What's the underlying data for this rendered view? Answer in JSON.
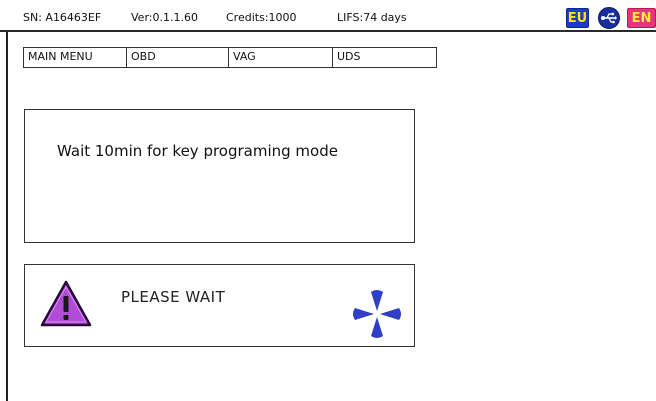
{
  "statusbar": {
    "sn": "SN: A16463EF",
    "version": "Ver:0.1.1.60",
    "credits": "Credits:1000",
    "lifs": "LIFS:74 days",
    "region_flag": "EU",
    "language_flag": "EN",
    "usb_icon": "usb-icon"
  },
  "menubar": {
    "items": [
      {
        "label": "MAIN MENU"
      },
      {
        "label": "OBD"
      },
      {
        "label": "VAG"
      },
      {
        "label": "UDS"
      }
    ]
  },
  "message": {
    "text": "Wait 10min for key programing mode"
  },
  "wait": {
    "text": "PLEASE WAIT",
    "warning_icon": "warning-triangle-icon",
    "spinner_icon": "spinner-icon"
  },
  "colors": {
    "warning_fill": "#b04cd8",
    "spinner": "#2f3fc8",
    "eu_flag": "#1b3cc8",
    "en_flag": "#e8347c"
  }
}
